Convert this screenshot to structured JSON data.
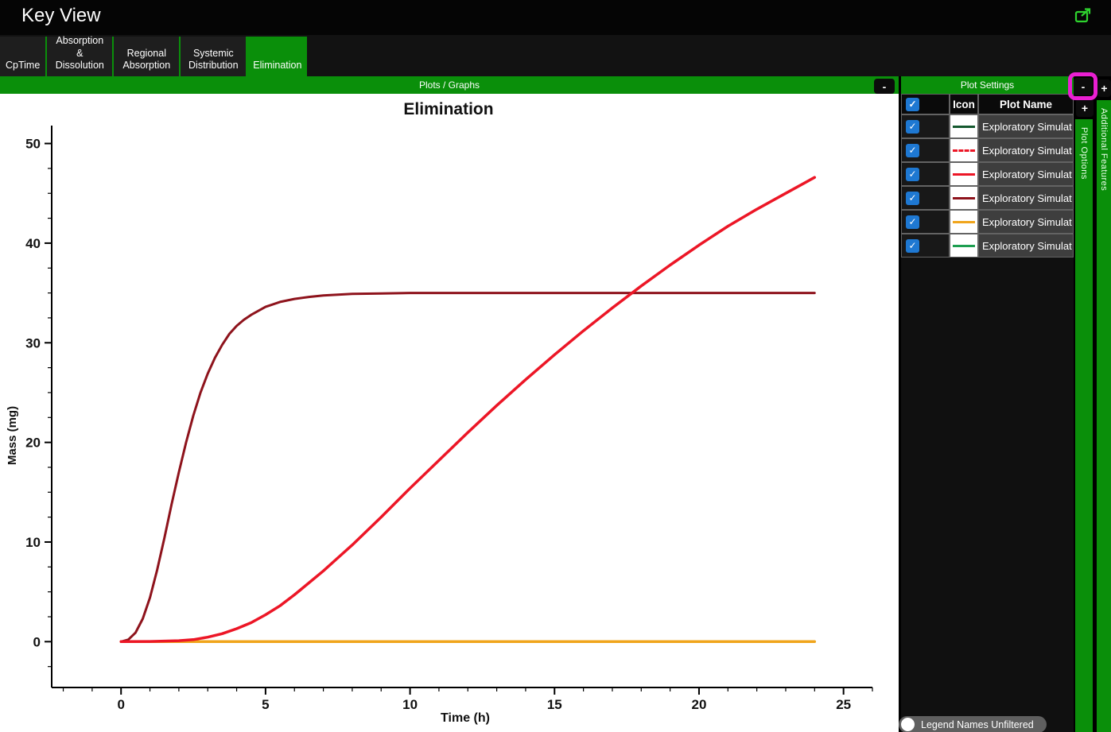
{
  "window": {
    "title": "Key View"
  },
  "tabs": [
    {
      "label": "CpTime",
      "active": false
    },
    {
      "label": "Absorption & Dissolution",
      "active": false
    },
    {
      "label": "Regional Absorption",
      "active": false
    },
    {
      "label": "Systemic Distribution",
      "active": false
    },
    {
      "label": "Elimination",
      "active": true
    }
  ],
  "panels": {
    "plots_graphs": {
      "title": "Plots / Graphs",
      "collapse_label": "-"
    },
    "plot_settings": {
      "title": "Plot Settings",
      "collapse_label": "-",
      "expand_label": "+",
      "add_label": "+"
    },
    "side_strips": [
      {
        "label": "Plot Options"
      },
      {
        "label": "Additional Features"
      }
    ]
  },
  "table": {
    "columns": [
      "",
      "Icon",
      "Plot Name"
    ],
    "header_checkbox_checked": true,
    "check_glyph": "✓",
    "rows": [
      {
        "checked": true,
        "icon_color": "#14582e",
        "icon_dash": false,
        "name": "Exploratory Simulat"
      },
      {
        "checked": true,
        "icon_color": "#ec1626",
        "icon_dash": true,
        "name": "Exploratory Simulat"
      },
      {
        "checked": true,
        "icon_color": "#ec1626",
        "icon_dash": false,
        "name": "Exploratory Simulat"
      },
      {
        "checked": true,
        "icon_color": "#8e131c",
        "icon_dash": false,
        "name": "Exploratory Simulat"
      },
      {
        "checked": true,
        "icon_color": "#f0a51c",
        "icon_dash": false,
        "name": "Exploratory Simulat"
      },
      {
        "checked": true,
        "icon_color": "#1d9e50",
        "icon_dash": false,
        "name": "Exploratory Simulat"
      }
    ]
  },
  "toggle": {
    "label": "Legend Names Unfiltered",
    "on": false
  },
  "annotation": {
    "highlight_color": "#ea1fd2",
    "target": "plot-settings-collapse-button"
  },
  "colors": {
    "accent_green": "#0a8f0a",
    "export_icon_green": "#2ed32e",
    "checkbox_blue": "#1e78d2"
  },
  "chart_data": {
    "type": "line",
    "title": "Elimination",
    "xlabel": "Time (h)",
    "ylabel": "Mass (mg)",
    "x_ticks": [
      0,
      5,
      10,
      15,
      20,
      25
    ],
    "y_ticks": [
      0,
      10,
      20,
      30,
      40,
      50
    ],
    "x_minor_step": 1,
    "y_minor_step": 2.5,
    "xlim": [
      -2.4,
      26
    ],
    "ylim": [
      -4.6,
      51.8
    ],
    "grid": false,
    "legend_position": "right-table",
    "series": [
      {
        "name": "Exploratory Simulat",
        "color": "#14582e",
        "dash": false,
        "width": 2.5,
        "points": [
          [
            0,
            0
          ],
          [
            24,
            0
          ]
        ]
      },
      {
        "name": "Exploratory Simulat",
        "color": "#ec1626",
        "dash": true,
        "width": 3,
        "points": [
          [
            0,
            0
          ],
          [
            24,
            0
          ]
        ]
      },
      {
        "name": "Exploratory Simulat",
        "color": "#1d9e50",
        "dash": false,
        "width": 2.5,
        "points": [
          [
            0,
            0
          ],
          [
            24,
            0
          ]
        ]
      },
      {
        "name": "Exploratory Simulat",
        "color": "#f0a51c",
        "dash": false,
        "width": 3.5,
        "points": [
          [
            0,
            0
          ],
          [
            24,
            0
          ]
        ]
      },
      {
        "name": "Exploratory Simulat",
        "color": "#8e131c",
        "dash": false,
        "width": 3,
        "points": [
          [
            0,
            0
          ],
          [
            0.25,
            0.2
          ],
          [
            0.5,
            0.9
          ],
          [
            0.75,
            2.3
          ],
          [
            1,
            4.4
          ],
          [
            1.25,
            7.2
          ],
          [
            1.5,
            10.4
          ],
          [
            1.75,
            13.8
          ],
          [
            2,
            17
          ],
          [
            2.25,
            20
          ],
          [
            2.5,
            22.7
          ],
          [
            2.75,
            25
          ],
          [
            3,
            26.9
          ],
          [
            3.25,
            28.5
          ],
          [
            3.5,
            29.8
          ],
          [
            3.75,
            30.9
          ],
          [
            4,
            31.7
          ],
          [
            4.25,
            32.3
          ],
          [
            4.5,
            32.8
          ],
          [
            5,
            33.6
          ],
          [
            5.5,
            34.1
          ],
          [
            6,
            34.4
          ],
          [
            6.5,
            34.6
          ],
          [
            7,
            34.75
          ],
          [
            8,
            34.9
          ],
          [
            9,
            34.95
          ],
          [
            10,
            35
          ],
          [
            12,
            35
          ],
          [
            24,
            35
          ]
        ]
      },
      {
        "name": "Exploratory Simulat",
        "color": "#ec1626",
        "dash": false,
        "width": 3.5,
        "points": [
          [
            0,
            0
          ],
          [
            1,
            0.02
          ],
          [
            2,
            0.1
          ],
          [
            2.5,
            0.2
          ],
          [
            3,
            0.45
          ],
          [
            3.5,
            0.8
          ],
          [
            4,
            1.3
          ],
          [
            4.5,
            1.9
          ],
          [
            5,
            2.7
          ],
          [
            5.5,
            3.6
          ],
          [
            6,
            4.7
          ],
          [
            6.5,
            5.9
          ],
          [
            7,
            7.1
          ],
          [
            7.5,
            8.4
          ],
          [
            8,
            9.7
          ],
          [
            9,
            12.5
          ],
          [
            10,
            15.4
          ],
          [
            11,
            18.2
          ],
          [
            12,
            21
          ],
          [
            13,
            23.7
          ],
          [
            14,
            26.3
          ],
          [
            15,
            28.8
          ],
          [
            16,
            31.2
          ],
          [
            17,
            33.5
          ],
          [
            18,
            35.7
          ],
          [
            19,
            37.8
          ],
          [
            20,
            39.8
          ],
          [
            21,
            41.7
          ],
          [
            22,
            43.4
          ],
          [
            23,
            45
          ],
          [
            24,
            46.6
          ]
        ]
      }
    ]
  }
}
